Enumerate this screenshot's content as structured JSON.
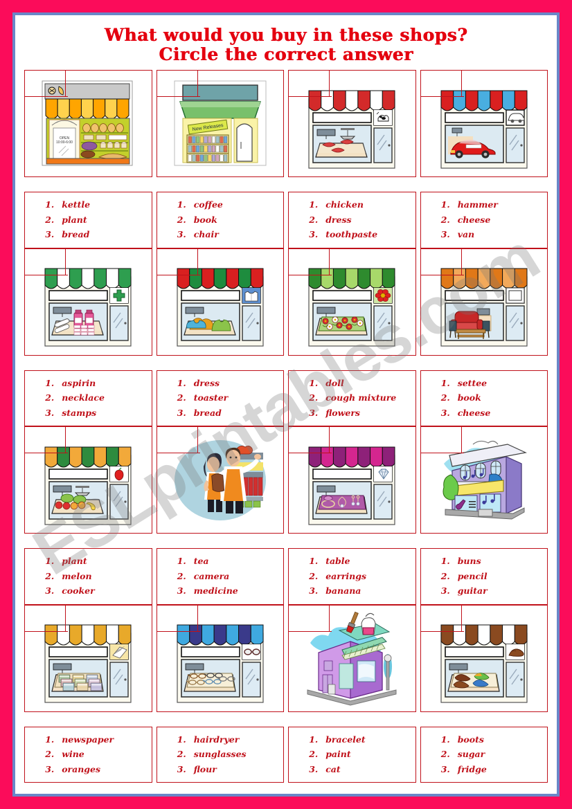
{
  "worksheet": {
    "title_line1": "What would you buy in these shops?",
    "title_line2": "Circle the correct answer",
    "watermark": "ESLprintables.com",
    "title_color": "#E4000F",
    "answer_color": "#C0111A",
    "page_border_color": "#FB0C5A",
    "inner_frame_color": "#6A87C8"
  },
  "items": [
    {
      "shop": "bakery",
      "sign": "OPEN 10:00-6:00",
      "options": [
        {
          "num": "1.",
          "text": "kettle"
        },
        {
          "num": "2.",
          "text": "plant"
        },
        {
          "num": "3.",
          "text": "bread"
        }
      ]
    },
    {
      "shop": "bookshop",
      "sign": "New Releases",
      "options": [
        {
          "num": "1.",
          "text": "coffee"
        },
        {
          "num": "2.",
          "text": "book"
        },
        {
          "num": "3.",
          "text": "chair"
        }
      ]
    },
    {
      "shop": "butcher",
      "sign": "",
      "options": [
        {
          "num": "1.",
          "text": "chicken"
        },
        {
          "num": "2.",
          "text": "dress"
        },
        {
          "num": "3.",
          "text": "toothpaste"
        }
      ]
    },
    {
      "shop": "car-dealer",
      "sign": "",
      "options": [
        {
          "num": "1.",
          "text": "hammer"
        },
        {
          "num": "2.",
          "text": "cheese"
        },
        {
          "num": "3.",
          "text": "van"
        }
      ]
    },
    {
      "shop": "pharmacy",
      "sign": "",
      "options": [
        {
          "num": "1.",
          "text": "aspirin"
        },
        {
          "num": "2.",
          "text": "necklace"
        },
        {
          "num": "3.",
          "text": "stamps"
        }
      ]
    },
    {
      "shop": "clothes",
      "sign": "",
      "options": [
        {
          "num": "1.",
          "text": "dress"
        },
        {
          "num": "2.",
          "text": "toaster"
        },
        {
          "num": "3.",
          "text": "bread"
        }
      ]
    },
    {
      "shop": "florist",
      "sign": "",
      "options": [
        {
          "num": "1.",
          "text": "doll"
        },
        {
          "num": "2.",
          "text": "cough mixture"
        },
        {
          "num": "3.",
          "text": "flowers"
        }
      ]
    },
    {
      "shop": "furniture",
      "sign": "",
      "options": [
        {
          "num": "1.",
          "text": "settee"
        },
        {
          "num": "2.",
          "text": "book"
        },
        {
          "num": "3.",
          "text": "cheese"
        }
      ]
    },
    {
      "shop": "greengrocer",
      "sign": "",
      "options": [
        {
          "num": "1.",
          "text": "plant"
        },
        {
          "num": "2.",
          "text": "melon"
        },
        {
          "num": "3.",
          "text": "cooker"
        }
      ]
    },
    {
      "shop": "grocery-staff",
      "sign": "",
      "options": [
        {
          "num": "1.",
          "text": "tea"
        },
        {
          "num": "2.",
          "text": "camera"
        },
        {
          "num": "3.",
          "text": "medicine"
        }
      ]
    },
    {
      "shop": "jewellery",
      "sign": "",
      "options": [
        {
          "num": "1.",
          "text": "table"
        },
        {
          "num": "2.",
          "text": "earrings"
        },
        {
          "num": "3.",
          "text": "banana"
        }
      ]
    },
    {
      "shop": "music-shop",
      "sign": "",
      "options": [
        {
          "num": "1.",
          "text": "buns"
        },
        {
          "num": "2.",
          "text": "pencil"
        },
        {
          "num": "3.",
          "text": "guitar"
        }
      ]
    },
    {
      "shop": "newsagent",
      "sign": "",
      "options": [
        {
          "num": "1.",
          "text": "newspaper"
        },
        {
          "num": "2.",
          "text": "wine"
        },
        {
          "num": "3.",
          "text": "oranges"
        }
      ]
    },
    {
      "shop": "optician",
      "sign": "",
      "options": [
        {
          "num": "1.",
          "text": "hairdryer"
        },
        {
          "num": "2.",
          "text": "sunglasses"
        },
        {
          "num": "3.",
          "text": "flour"
        }
      ]
    },
    {
      "shop": "paint-shop",
      "sign": "",
      "options": [
        {
          "num": "1.",
          "text": "bracelet"
        },
        {
          "num": "2.",
          "text": "paint"
        },
        {
          "num": "3.",
          "text": "cat"
        }
      ]
    },
    {
      "shop": "shoe-shop",
      "sign": "",
      "options": [
        {
          "num": "1.",
          "text": "boots"
        },
        {
          "num": "2.",
          "text": "sugar"
        },
        {
          "num": "3.",
          "text": "fridge"
        }
      ]
    }
  ]
}
